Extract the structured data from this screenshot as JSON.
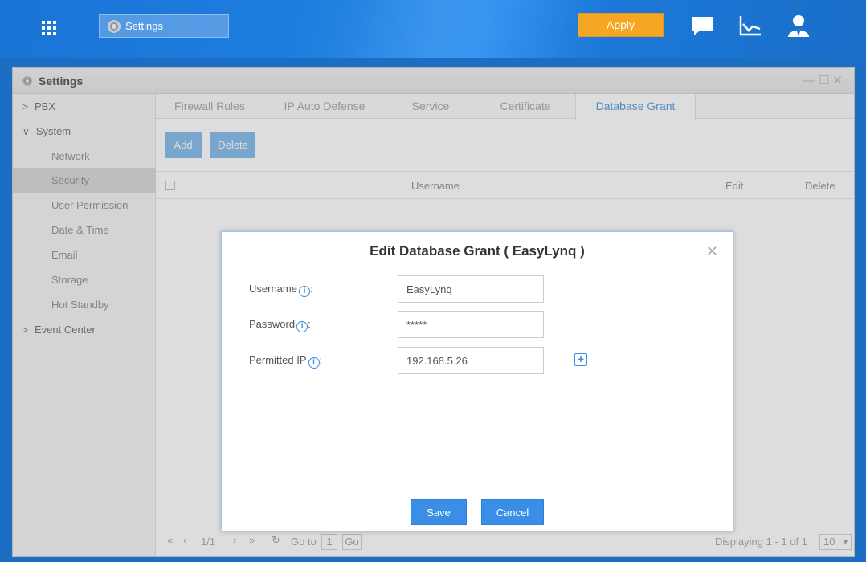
{
  "topbar": {
    "task_label": "Settings",
    "apply_label": "Apply",
    "icons": [
      "grid-icon",
      "message-icon",
      "chart-icon",
      "user-icon"
    ],
    "accent": "#f5a623"
  },
  "window": {
    "title": "Settings",
    "controls": [
      "minimize",
      "maximize",
      "close"
    ]
  },
  "sidebar": {
    "items": [
      {
        "label": "PBX",
        "type": "group",
        "expanded": false
      },
      {
        "label": "System",
        "type": "group",
        "expanded": true
      },
      {
        "label": "Network",
        "type": "sub"
      },
      {
        "label": "Security",
        "type": "sub",
        "active": true
      },
      {
        "label": "User Permission",
        "type": "sub"
      },
      {
        "label": "Date & Time",
        "type": "sub"
      },
      {
        "label": "Email",
        "type": "sub"
      },
      {
        "label": "Storage",
        "type": "sub"
      },
      {
        "label": "Hot Standby",
        "type": "sub"
      },
      {
        "label": "Event Center",
        "type": "group",
        "expanded": false
      }
    ]
  },
  "tabs": [
    "Firewall Rules",
    "IP Auto Defense",
    "Service",
    "Certificate",
    "Database Grant"
  ],
  "active_tab": "Database Grant",
  "toolbar": {
    "add_label": "Add",
    "delete_label": "Delete"
  },
  "table": {
    "columns": [
      "Username",
      "Edit",
      "Delete"
    ]
  },
  "pager": {
    "page": "1/1",
    "goto_label": "Go to",
    "goto_value": "1",
    "go_label": "Go",
    "displaying": "Displaying 1 - 1 of 1",
    "page_size": "10"
  },
  "dialog": {
    "title": "Edit Database Grant ( EasyLynq )",
    "fields": [
      {
        "label": "Username",
        "value": "EasyLynq"
      },
      {
        "label": "Password",
        "value": "*****"
      },
      {
        "label": "Permitted IP",
        "value": "192.168.5.26"
      }
    ],
    "save_label": "Save",
    "cancel_label": "Cancel",
    "accent": "#3a8ee6"
  }
}
